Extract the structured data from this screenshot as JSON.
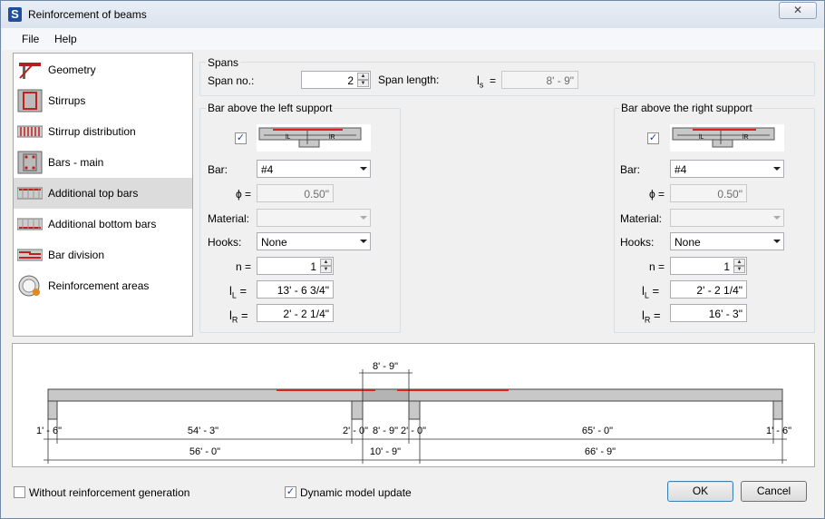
{
  "window": {
    "title": "Reinforcement of beams",
    "app_icon": "S",
    "close_glyph": "✕"
  },
  "menu": [
    {
      "label": "File"
    },
    {
      "label": "Help"
    }
  ],
  "sidebar": {
    "selected_index": 4,
    "items": [
      {
        "label": "Geometry",
        "icon": "geometry-icon"
      },
      {
        "label": "Stirrups",
        "icon": "stirrups-icon"
      },
      {
        "label": "Stirrup distribution",
        "icon": "stirrup-distribution-icon"
      },
      {
        "label": "Bars - main",
        "icon": "main-bars-icon"
      },
      {
        "label": "Additional top bars",
        "icon": "additional-top-bars-icon"
      },
      {
        "label": "Additional bottom bars",
        "icon": "additional-bottom-bars-icon"
      },
      {
        "label": "Bar division",
        "icon": "bar-division-icon"
      },
      {
        "label": "Reinforcement areas",
        "icon": "reinforcement-areas-icon"
      }
    ]
  },
  "spans": {
    "group_label": "Spans",
    "span_no_label": "Span no.:",
    "span_no_value": "2",
    "span_length_label": "Span length:",
    "ls_label": "l",
    "ls_sub": "s",
    "eq": "=",
    "ls_value": "8' - 9\""
  },
  "left": {
    "group_label": "Bar above the left support",
    "checked": true,
    "check_glyph": "✓",
    "bar_label": "Bar:",
    "bar_value": "#4",
    "phi_label": "ϕ =",
    "phi_value": "0.50\"",
    "material_label": "Material:",
    "material_value": "",
    "hooks_label": "Hooks:",
    "hooks_value": "None",
    "n_label": "n =",
    "n_value": "1",
    "lL_label": "l",
    "lL_sub": "L",
    "lL_eq": "=",
    "lL_value": "13' - 6 3/4\"",
    "lR_label": "l",
    "lR_sub": "R",
    "lR_eq": "=",
    "lR_value": "2' - 2 1/4\"",
    "diagram_L": "lL",
    "diagram_R": "lR"
  },
  "right": {
    "group_label": "Bar above the right support",
    "checked": true,
    "check_glyph": "✓",
    "bar_label": "Bar:",
    "bar_value": "#4",
    "phi_label": "ϕ =",
    "phi_value": "0.50\"",
    "material_label": "Material:",
    "material_value": "",
    "hooks_label": "Hooks:",
    "hooks_value": "None",
    "n_label": "n =",
    "n_value": "1",
    "lL_label": "l",
    "lL_sub": "L",
    "lL_eq": "=",
    "lL_value": "2' - 2 1/4\"",
    "lR_label": "l",
    "lR_sub": "R",
    "lR_eq": "=",
    "lR_value": "16' - 3\"",
    "diagram_L": "lL",
    "diagram_R": "lR"
  },
  "preview": {
    "span_top": "8' - 9\"",
    "row1": [
      "1' - 6\"",
      "54' - 3\"",
      "2' - 0\"",
      "8' - 9\"",
      "2' - 0\"",
      "65' - 0\"",
      "1' - 6\""
    ],
    "row2": [
      "56' - 0\"",
      "10' - 9\"",
      "66' - 9\""
    ]
  },
  "footer": {
    "without_reinf_label": "Without reinforcement generation",
    "without_reinf_checked": false,
    "dynamic_label": "Dynamic model update",
    "dynamic_checked": true,
    "check_glyph": "✓",
    "ok_label": "OK",
    "cancel_label": "Cancel"
  },
  "colors": {
    "bar_red": "#e0201c",
    "beam_gray": "#c8c8c8",
    "accent": "#3c7fb1"
  }
}
